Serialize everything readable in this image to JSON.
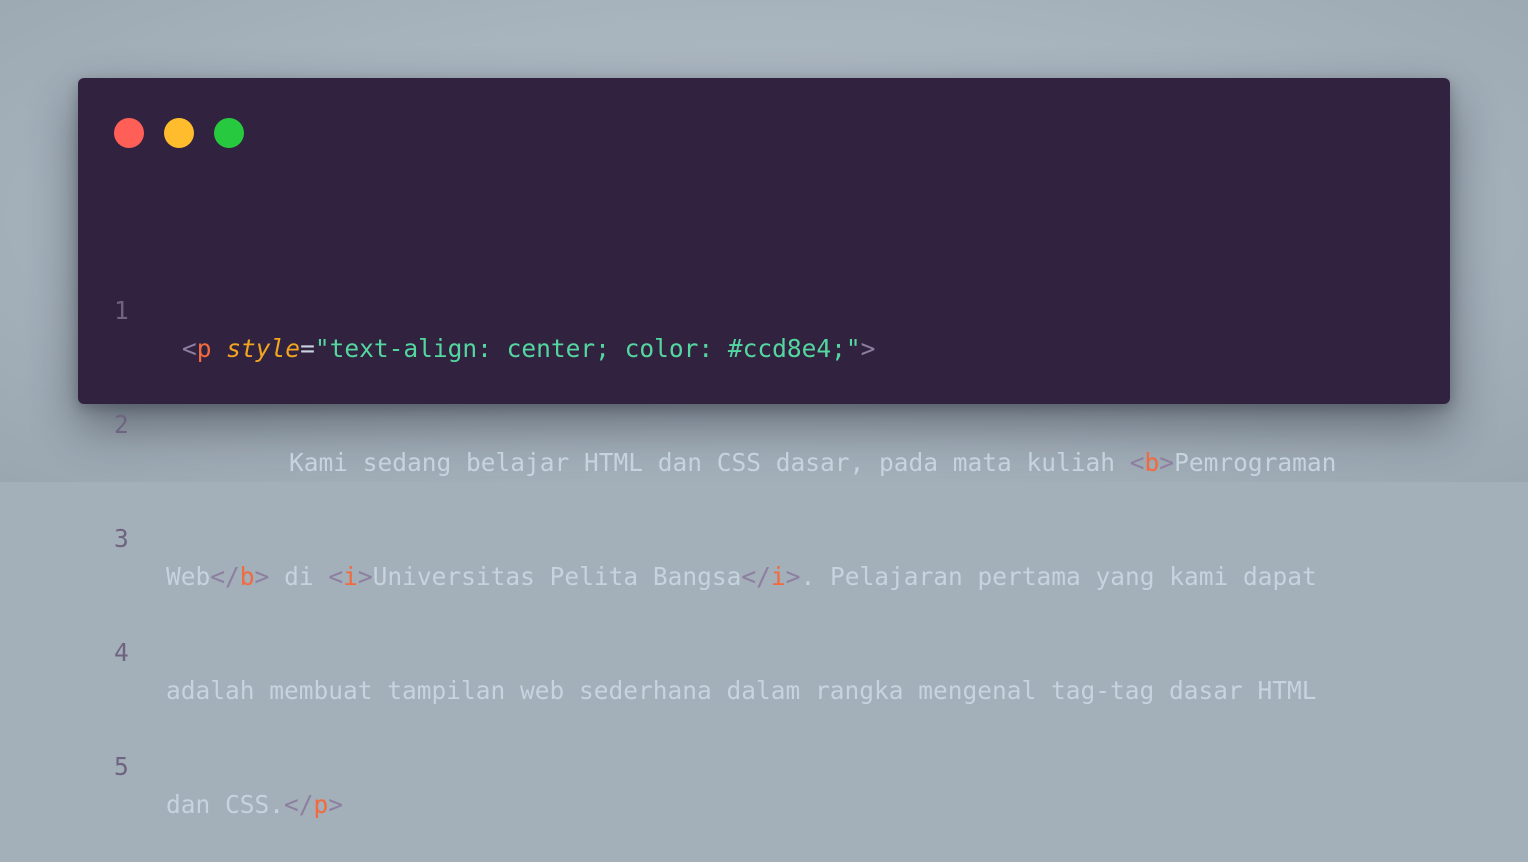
{
  "window": {
    "controls": [
      "close",
      "minimize",
      "maximize"
    ],
    "colors": {
      "close": "#ff5f56",
      "minimize": "#ffbd2e",
      "maximize": "#27c93f",
      "background": "#31233f"
    }
  },
  "code": {
    "line_numbers": [
      "1",
      "2",
      "3",
      "4",
      "5"
    ],
    "line1": {
      "lt": "<",
      "tag": "p",
      "attr": "style",
      "eq": "=",
      "value": "\"text-align: center; color: #ccd8e4;\"",
      "gt": ">"
    },
    "line2": {
      "text": "Kami sedang belajar HTML dan CSS dasar, pada mata kuliah ",
      "b_open_lt": "<",
      "b_open_tag": "b",
      "b_open_gt": ">",
      "text_after": "Pemrograman"
    },
    "line3": {
      "text_start": "Web",
      "b_close_lt": "</",
      "b_close_tag": "b",
      "b_close_gt": ">",
      "text_mid1": " di ",
      "i_open_lt": "<",
      "i_open_tag": "i",
      "i_open_gt": ">",
      "italic_text": "Universitas Pelita Bangsa",
      "i_close_lt": "</",
      "i_close_tag": "i",
      "i_close_gt": ">",
      "text_end": ". Pelajaran pertama yang kami dapat"
    },
    "line4": {
      "text": "adalah membuat tampilan web sederhana dalam rangka mengenal tag-tag dasar HTML"
    },
    "line5": {
      "text": "dan CSS.",
      "p_close_lt": "</",
      "p_close_tag": "p",
      "p_close_gt": ">"
    }
  }
}
